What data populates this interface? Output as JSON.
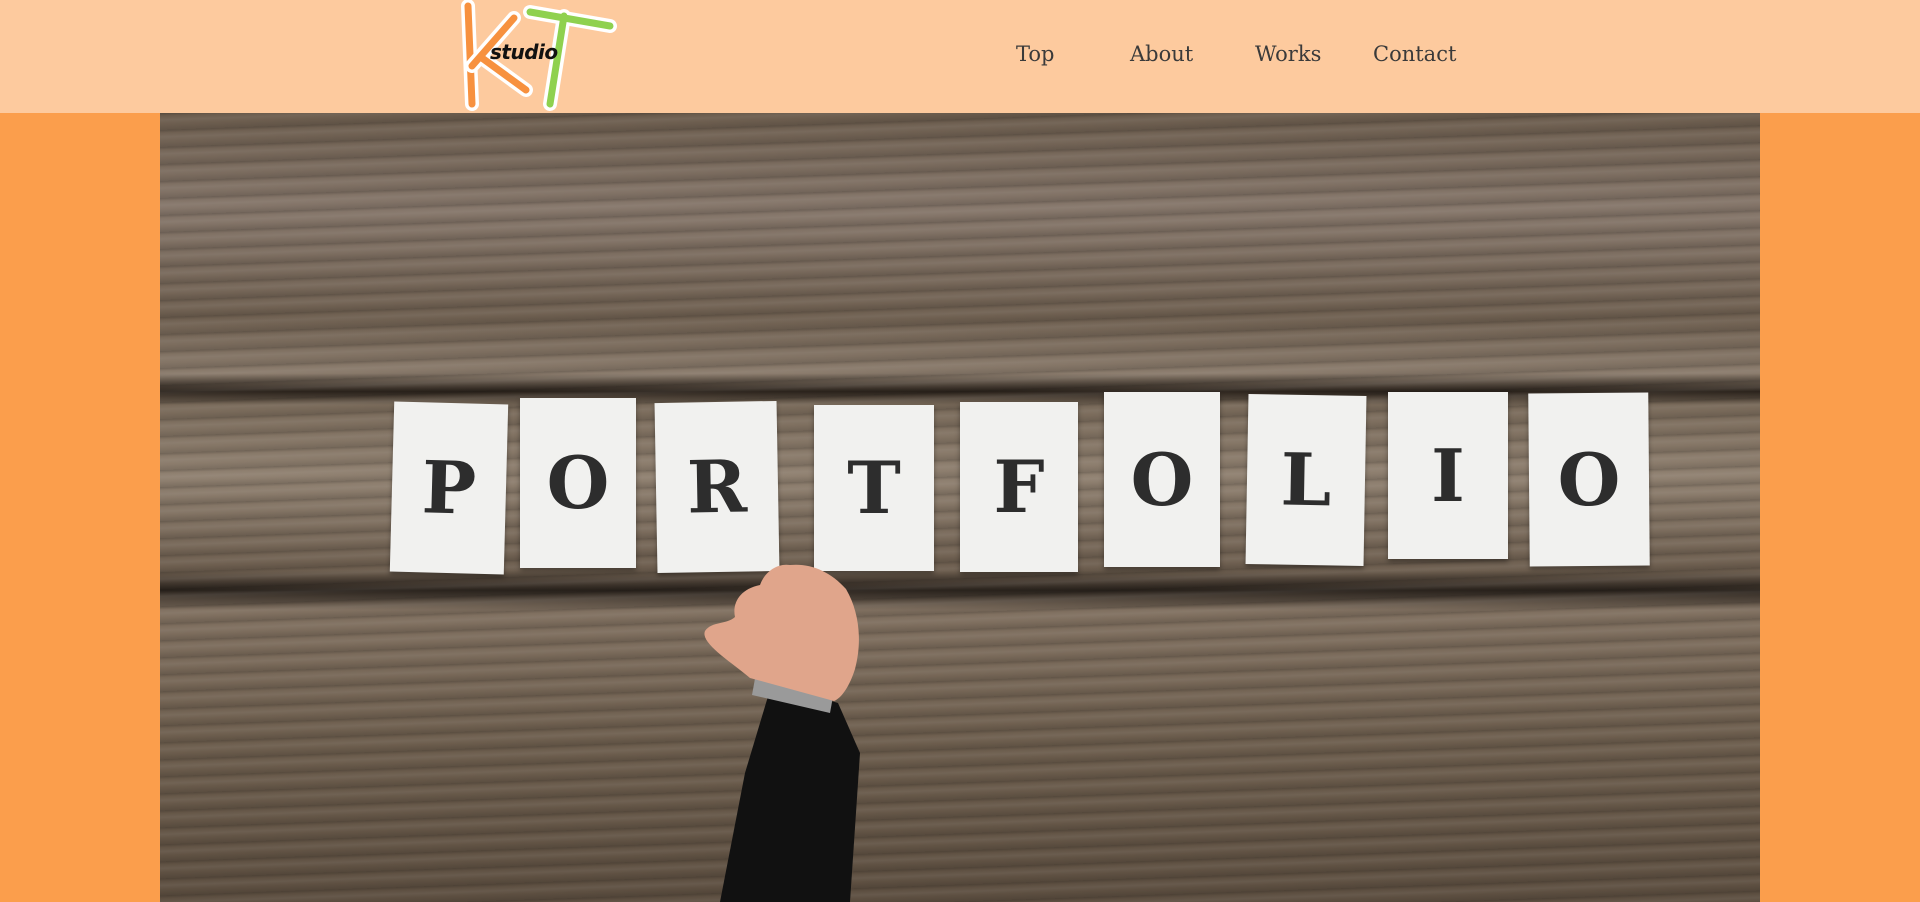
{
  "logo": {
    "letters": "KT",
    "studio_text": "studio",
    "k_color": "#f7913f",
    "t_color": "#8fd14f"
  },
  "nav": {
    "items": [
      "Top",
      "About",
      "Works",
      "Contact"
    ]
  },
  "hero": {
    "image": "wooden-table-with-portfolio-letter-cards",
    "letters": [
      "P",
      "O",
      "R",
      "T",
      "F",
      "O",
      "L",
      "I",
      "O"
    ]
  },
  "colors": {
    "page_bg": "#fb9e4c",
    "header_bg": "#fdca9e",
    "nav_text": "#3a3a3a"
  }
}
